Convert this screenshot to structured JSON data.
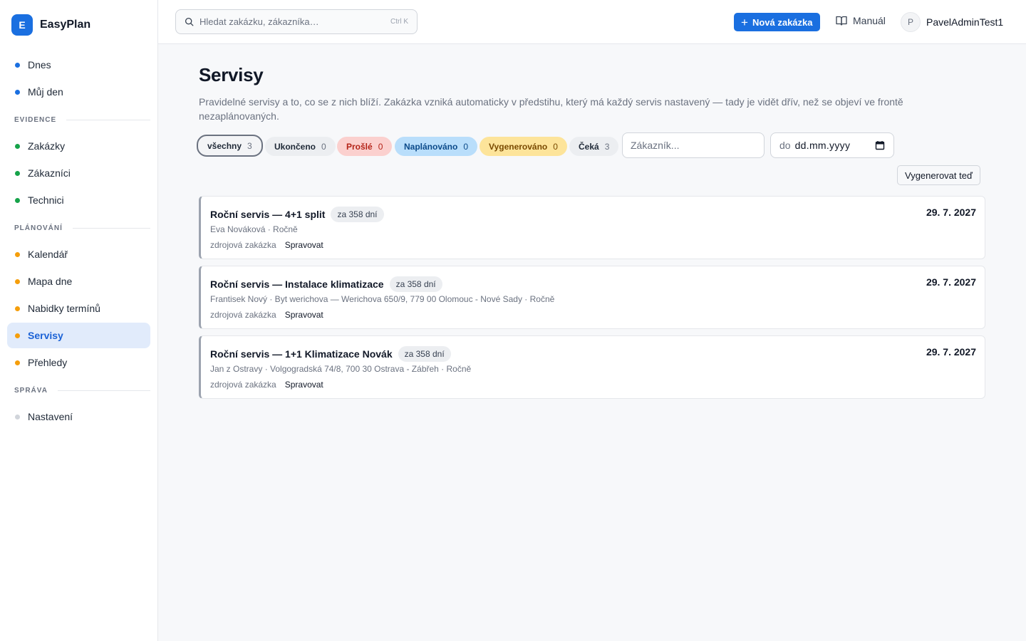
{
  "brand": {
    "logo_letter": "E",
    "name": "EasyPlan",
    "accent": "#1a6fe0"
  },
  "sidebar": {
    "items_top": [
      {
        "label": "Dnes",
        "dot": "#1a6fe0"
      },
      {
        "label": "Můj den",
        "dot": "#1a6fe0"
      }
    ],
    "sections": [
      {
        "title": "EVIDENCE",
        "items": [
          {
            "label": "Zakázky",
            "dot": "#16a34a"
          },
          {
            "label": "Zákazníci",
            "dot": "#16a34a"
          },
          {
            "label": "Technici",
            "dot": "#16a34a"
          }
        ]
      },
      {
        "title": "PLÁNOVÁNÍ",
        "items": [
          {
            "label": "Kalendář",
            "dot": "#f59e0b"
          },
          {
            "label": "Mapa dne",
            "dot": "#f59e0b"
          },
          {
            "label": "Nabidky termínů",
            "dot": "#f59e0b"
          },
          {
            "label": "Servisy",
            "dot": "#f59e0b",
            "active": true
          },
          {
            "label": "Přehledy",
            "dot": "#f59e0b"
          }
        ]
      },
      {
        "title": "SPRÁVA",
        "items": [
          {
            "label": "Nastavení",
            "dot": "#d1d5db"
          }
        ]
      }
    ]
  },
  "topbar": {
    "search_placeholder": "Hledat zakázku, zákazníka…",
    "search_shortcut": "Ctrl K",
    "new_order_label": "Nová zakázka",
    "manual_label": "Manuál",
    "user_initial": "P",
    "user_name": "PavelAdminTest1"
  },
  "page": {
    "title": "Servisy",
    "description": "Pravidelné servisy a to, co se z nich blíží. Zakázka vzniká automaticky v předstihu, který má každý servis nastavený — tady je vidět dřív, než se objeví ve frontě nezaplánovaných."
  },
  "filters": {
    "chips": [
      {
        "label": "všechny",
        "count": "3",
        "selected": true
      },
      {
        "label": "Ukončeno",
        "count": "0"
      },
      {
        "label": "Prošlé",
        "count": "0",
        "color": "#fbd0ce"
      },
      {
        "label": "Naplánováno",
        "count": "0",
        "color": "#b9defb"
      },
      {
        "label": "Vygenerováno",
        "count": "0",
        "color": "#fde49a"
      },
      {
        "label": "Čeká",
        "count": "3"
      }
    ],
    "customer_placeholder": "Zákazník...",
    "date_label": "do",
    "date_value": "dd.mm.yyyy",
    "generate_label": "Vygenerovat teď"
  },
  "services": [
    {
      "title": "Roční servis — 4+1 split",
      "badge": "za 358 dní",
      "date": "29. 7. 2027",
      "subtitle": "Eva Nováková · Ročně",
      "source_label": "zdrojová zakázka",
      "manage_label": "Spravovat"
    },
    {
      "title": "Roční servis — Instalace klimatizace",
      "badge": "za 358 dní",
      "date": "29. 7. 2027",
      "subtitle": "Frantisek Nový · Byt werichova — Werichova 650/9, 779 00 Olomouc - Nové Sady · Ročně",
      "source_label": "zdrojová zakázka",
      "manage_label": "Spravovat"
    },
    {
      "title": "Roční servis — 1+1 Klimatizace Novák",
      "badge": "za 358 dní",
      "date": "29. 7. 2027",
      "subtitle": "Jan z Ostravy · Volgogradská 74/8, 700 30 Ostrava - Zábřeh · Ročně",
      "source_label": "zdrojová zakázka",
      "manage_label": "Spravovat"
    }
  ]
}
